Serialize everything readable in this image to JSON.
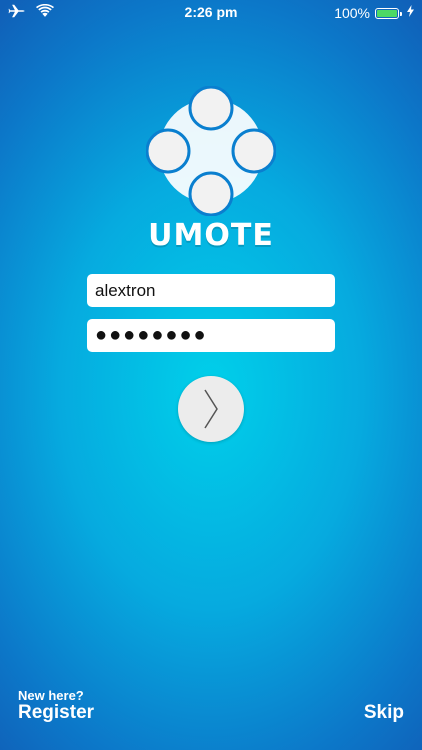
{
  "status_bar": {
    "time": "2:26 pm",
    "battery_percent": "100%",
    "battery_level": 1.0,
    "icons": [
      "airplane-icon",
      "wifi-icon",
      "battery-icon",
      "charging-icon"
    ]
  },
  "logo": {
    "brand": "UMOTE",
    "icon": "gamepad-buttons-logo"
  },
  "login": {
    "username_value": "alextron",
    "password_value": "●●●●●●●●",
    "submit_icon": "chevron-right-icon"
  },
  "footer": {
    "new_here": "New here?",
    "register_label": "Register",
    "skip_label": "Skip"
  },
  "colors": {
    "background_center": "#00d0ea",
    "background_edge": "#1060b8",
    "button_bg": "#ececec",
    "battery_fill": "#4cd964"
  }
}
